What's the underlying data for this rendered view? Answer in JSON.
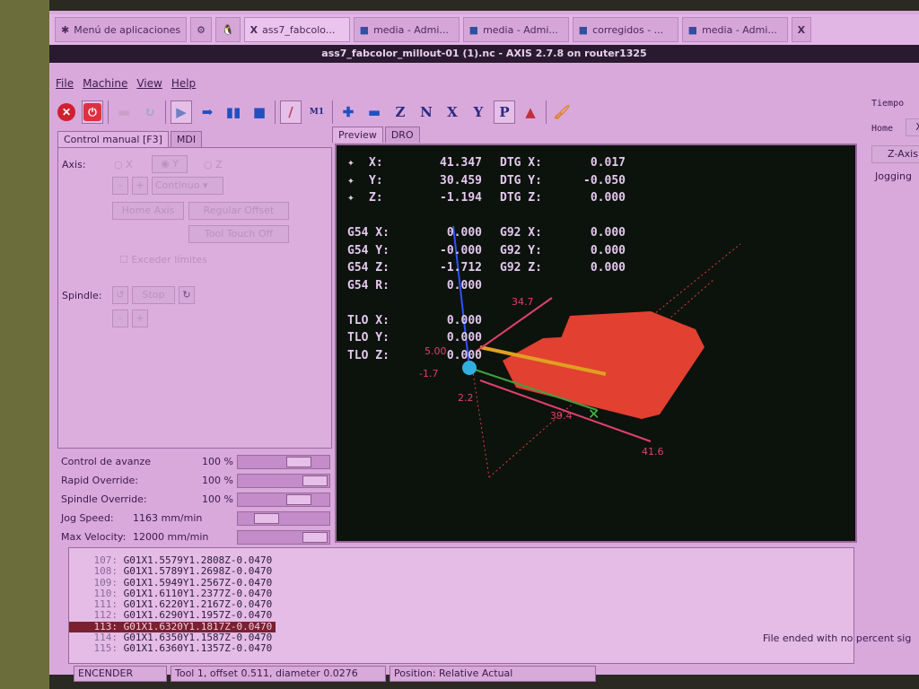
{
  "taskbar": {
    "menu": "Menú de aplicaciones",
    "items": [
      "ass7_fabcolo...",
      "media - Admi...",
      "media - Admi...",
      "corregidos - ...",
      "media - Admi..."
    ]
  },
  "window_title": "ass7_fabcolor_millout-01 (1).nc - AXIS 2.7.8 on router1325",
  "menu": [
    "File",
    "Machine",
    "View",
    "Help"
  ],
  "toolbar": {
    "z": "Z",
    "n": "N",
    "x": "X",
    "y": "Y",
    "p": "P",
    "m1": "M1"
  },
  "left_tabs": [
    "Control manual [F3]",
    "MDI"
  ],
  "manual": {
    "axis_label": "Axis:",
    "axes": [
      "X",
      "Y",
      "Z"
    ],
    "minus": "-",
    "plus": "+",
    "jog_mode": "Continuo",
    "home_axis": "Home Axis",
    "regular_offset": "Regular Offset",
    "tool_touch_off": "Tool Touch Off",
    "override_limits": "Exceder límites",
    "spindle_label": "Spindle:",
    "stop": "Stop"
  },
  "sliders": [
    {
      "name": "Control de avanze",
      "value": "100 %",
      "fraction": 0.75
    },
    {
      "name": "Rapid Override:",
      "value": "100 %",
      "fraction": 1.0
    },
    {
      "name": "Spindle Override:",
      "value": "100 %",
      "fraction": 0.75
    },
    {
      "name": "Jog Speed:",
      "value": "1163 mm/min",
      "fraction": 0.25
    },
    {
      "name": "Max Velocity:",
      "value": "12000 mm/min",
      "fraction": 1.0
    }
  ],
  "preview_tabs": [
    "Preview",
    "DRO"
  ],
  "dro": [
    [
      "X:",
      "41.347",
      "DTG X:",
      "0.017"
    ],
    [
      "Y:",
      "30.459",
      "DTG Y:",
      "-0.050"
    ],
    [
      "Z:",
      "-1.194",
      "DTG Z:",
      "0.000"
    ],
    [
      "",
      "",
      "",
      ""
    ],
    [
      "G54 X:",
      "0.000",
      "G92 X:",
      "0.000"
    ],
    [
      "G54 Y:",
      "-0.000",
      "G92 Y:",
      "0.000"
    ],
    [
      "G54 Z:",
      "-1.712",
      "G92 Z:",
      "0.000"
    ],
    [
      "G54 R:",
      "0.000",
      "",
      ""
    ],
    [
      "",
      "",
      "",
      ""
    ],
    [
      "TLO X:",
      "0.000",
      "",
      ""
    ],
    [
      "TLO Y:",
      "0.000",
      "",
      ""
    ],
    [
      "TLO Z:",
      "0.000",
      "",
      ""
    ]
  ],
  "plot_labels": {
    "a": "5.00",
    "b": "-1.7",
    "c": "2.2",
    "d": "39.4",
    "e": "41.6",
    "f": "34.7"
  },
  "right_panel": {
    "tiempo": "Tiempo",
    "home": "Home",
    "x": "X",
    "zaxis": "Z-Axis",
    "jogging": "Jogging"
  },
  "gcode": [
    {
      "n": "107:",
      "code": "G01X1.5579Y1.2808Z-0.0470"
    },
    {
      "n": "108:",
      "code": "G01X1.5789Y1.2698Z-0.0470"
    },
    {
      "n": "109:",
      "code": "G01X1.5949Y1.2567Z-0.0470"
    },
    {
      "n": "110:",
      "code": "G01X1.6110Y1.2377Z-0.0470"
    },
    {
      "n": "111:",
      "code": "G01X1.6220Y1.2167Z-0.0470"
    },
    {
      "n": "112:",
      "code": "G01X1.6290Y1.1957Z-0.0470"
    },
    {
      "n": "113:",
      "code": "G01X1.6320Y1.1817Z-0.0470",
      "active": true
    },
    {
      "n": "114:",
      "code": "G01X1.6350Y1.1587Z-0.0470"
    },
    {
      "n": "115:",
      "code": "G01X1.6360Y1.1357Z-0.0470"
    }
  ],
  "message": "File ended with no percent sig",
  "status": {
    "state": "ENCENDER",
    "tool": "Tool 1, offset 0.511, diameter 0.0276",
    "position": "Position: Relative Actual"
  }
}
